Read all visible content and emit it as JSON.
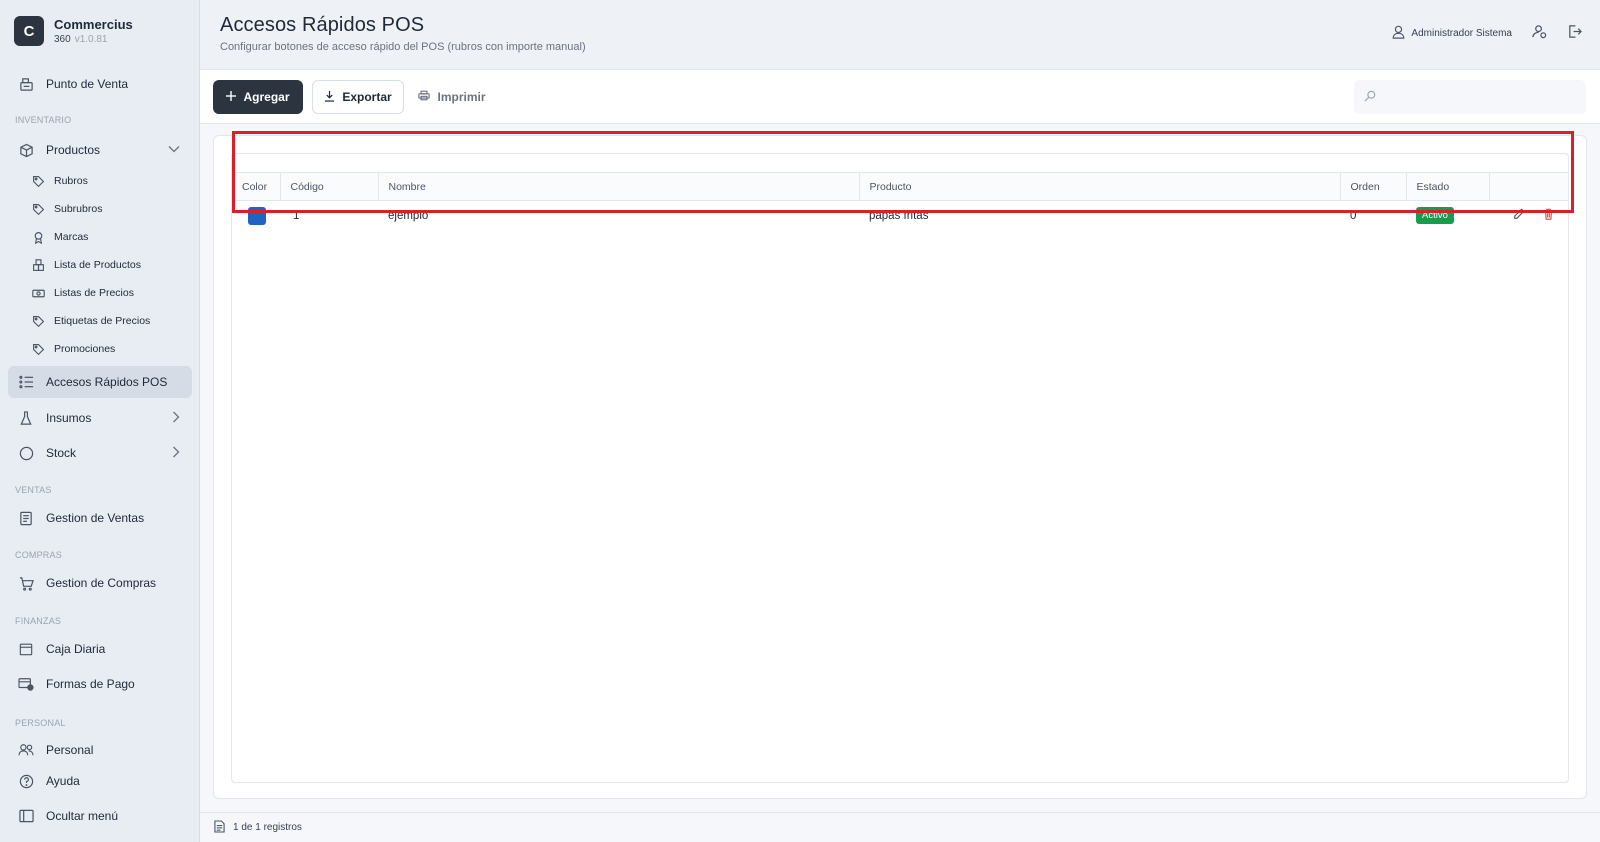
{
  "brand": {
    "logo_letter": "C",
    "name": "Commercius",
    "sub": "360",
    "version": "v1.0.81"
  },
  "sidebar": {
    "pos": "Punto de Venta",
    "sections": {
      "inventario": "INVENTARIO",
      "ventas": "VENTAS",
      "compras": "COMPRAS",
      "finanzas": "FINANZAS",
      "personal": "PERSONAL"
    },
    "productos": "Productos",
    "sub": [
      "Rubros",
      "Subrubros",
      "Marcas",
      "Lista de Productos",
      "Listas de Precios",
      "Etiquetas de Precios",
      "Promociones"
    ],
    "accesos": "Accesos Rápidos POS",
    "insumos": "Insumos",
    "stock": "Stock",
    "ventas": "Gestion de Ventas",
    "compras": "Gestion de Compras",
    "caja": "Caja Diaria",
    "formas": "Formas de Pago",
    "personal": "Personal",
    "ayuda": "Ayuda",
    "ocultar": "Ocultar menú"
  },
  "header": {
    "title": "Accesos Rápidos POS",
    "subtitle": "Configurar botones de acceso rápido del POS (rubros con importe manual)",
    "user": "Administrador Sistema"
  },
  "toolbar": {
    "add": "Agregar",
    "export": "Exportar",
    "print": "Imprimir",
    "search_placeholder": ""
  },
  "table": {
    "headers": [
      "Color",
      "Código",
      "Nombre",
      "Producto",
      "Orden",
      "Estado",
      ""
    ],
    "rows": [
      {
        "color": "#1f63c4",
        "codigo": "1",
        "nombre": "ejemplo",
        "producto": "papas fritas",
        "orden": "0",
        "estado": "Activo"
      }
    ]
  },
  "footer": {
    "records": "1 de 1 registros"
  },
  "colors": {
    "active_badge": "#159c4c",
    "sidebar_active": "#d5dce5",
    "primary": "#2c3440",
    "delete": "#d14b4b",
    "highlight": "#d7202a"
  }
}
